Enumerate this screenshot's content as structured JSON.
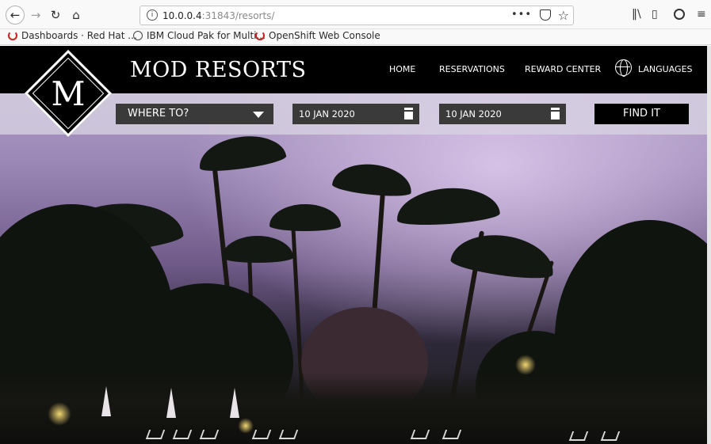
{
  "browser": {
    "url_host": "10.0.0.4",
    "url_path": ":31843/resorts/",
    "page_actions": "•••",
    "bookmarks": [
      {
        "label": "Dashboards · Red Hat ...",
        "icon": "redhat-icon"
      },
      {
        "label": "IBM Cloud Pak for Multi...",
        "icon": "globe-icon"
      },
      {
        "label": "OpenShift Web Console",
        "icon": "redhat-icon"
      }
    ]
  },
  "site": {
    "brand": "MOD RESORTS",
    "logo_letter": "M",
    "nav": {
      "home": "HOME",
      "reservations": "RESERVATIONS",
      "reward_center": "REWARD CENTER",
      "languages": "LANGUAGES"
    },
    "search": {
      "destination": "WHERE TO?",
      "check_in": "10 JAN 2020",
      "check_out": "10 JAN 2020",
      "submit": "FIND IT"
    }
  }
}
